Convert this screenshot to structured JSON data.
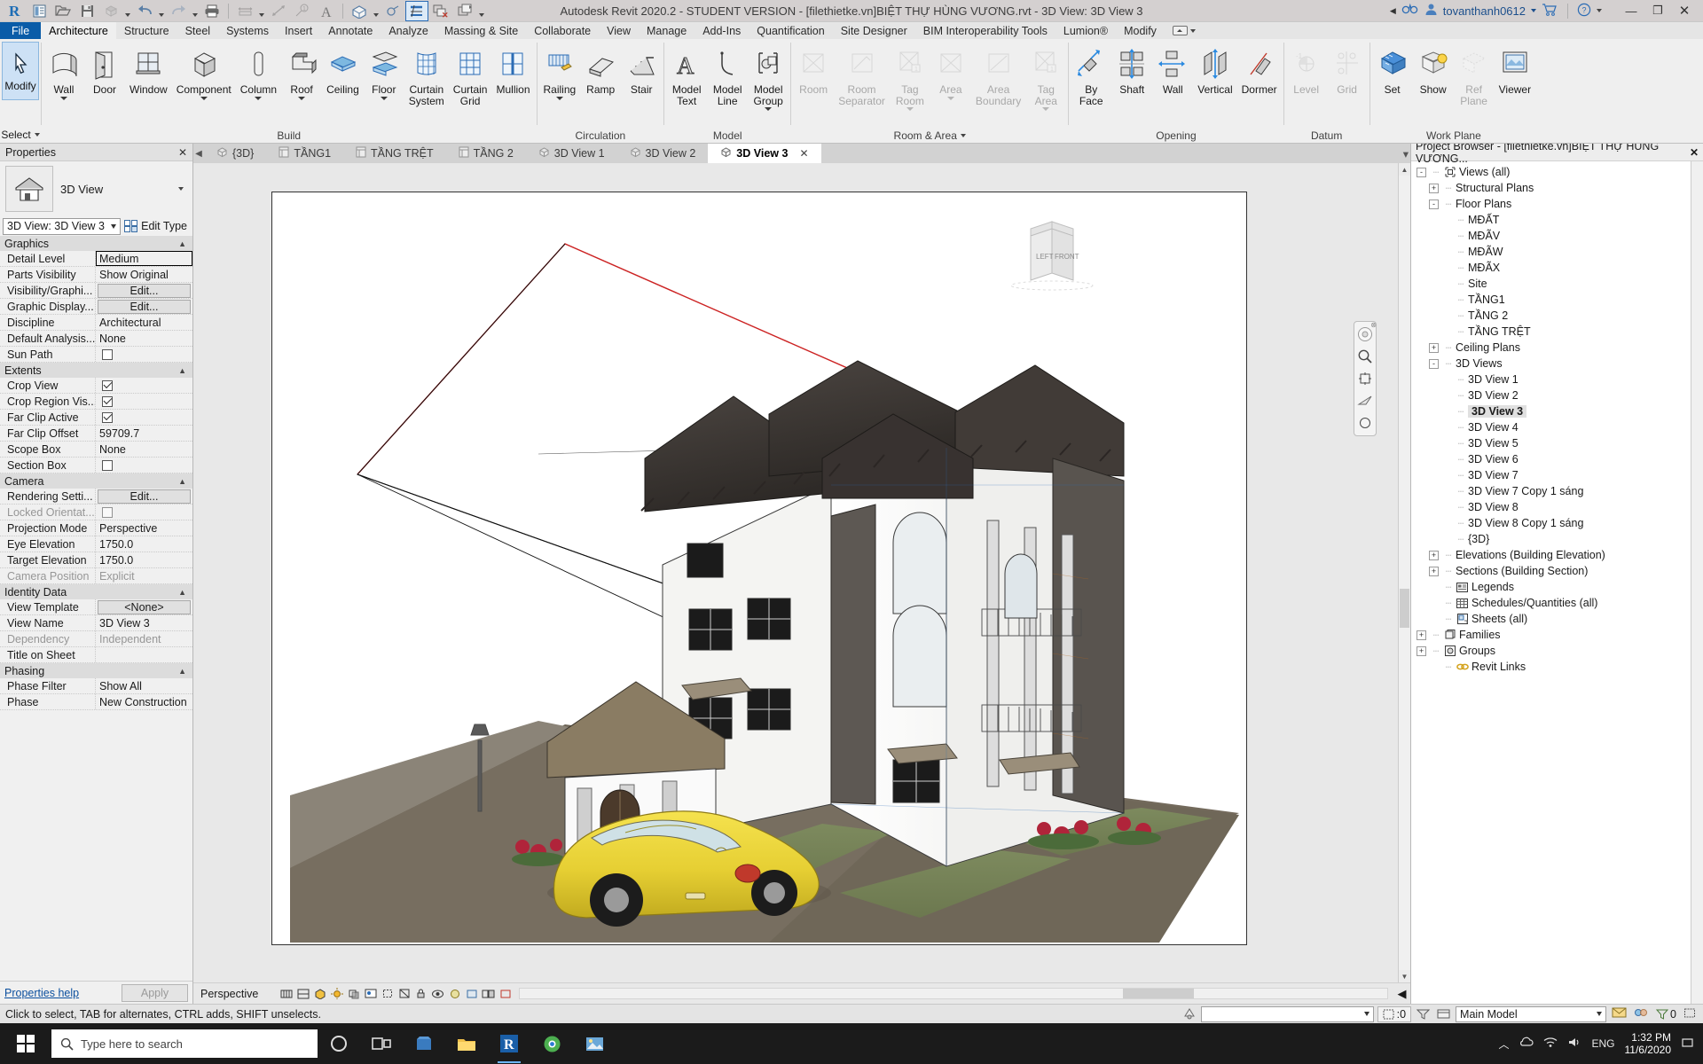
{
  "titlebar": {
    "title": "Autodesk Revit 2020.2 - STUDENT VERSION - [filethietke.vn]BIỆT THỰ HÙNG VƯƠNG.rvt - 3D View: 3D View 3",
    "user": "tovanthanh0612",
    "qat": [
      {
        "name": "revit-logo-icon",
        "label": "R"
      },
      {
        "name": "new-project-icon",
        "label": "New"
      },
      {
        "name": "open-icon",
        "label": "Open"
      },
      {
        "name": "save-icon",
        "label": "Save"
      },
      {
        "name": "sync-icon",
        "label": "Synchronize"
      },
      {
        "name": "undo-icon",
        "label": "Undo"
      },
      {
        "name": "redo-icon",
        "label": "Redo"
      },
      {
        "name": "print-icon",
        "label": "Print"
      },
      {
        "name": "measure-icon",
        "label": "Measure"
      },
      {
        "name": "aligned-dimension-icon",
        "label": "Aligned Dimension"
      },
      {
        "name": "tag-icon",
        "label": "Tag by Category"
      },
      {
        "name": "text-icon",
        "label": "Text"
      },
      {
        "name": "default-3d-view-icon",
        "label": "Default 3D View"
      },
      {
        "name": "section-icon",
        "label": "Section"
      },
      {
        "name": "thin-lines-icon",
        "label": "Thin Lines"
      },
      {
        "name": "close-hidden-windows-icon",
        "label": "Close Hidden Windows"
      },
      {
        "name": "switch-windows-icon",
        "label": "Switch Windows"
      }
    ],
    "buttons": {
      "minimize": "—",
      "maximize": "❐",
      "close": "✕"
    }
  },
  "ribbon": {
    "tabs": [
      {
        "label": "File",
        "state": "file"
      },
      {
        "label": "Architecture",
        "state": "active"
      },
      {
        "label": "Structure",
        "state": ""
      },
      {
        "label": "Steel",
        "state": ""
      },
      {
        "label": "Systems",
        "state": ""
      },
      {
        "label": "Insert",
        "state": ""
      },
      {
        "label": "Annotate",
        "state": ""
      },
      {
        "label": "Analyze",
        "state": ""
      },
      {
        "label": "Massing & Site",
        "state": ""
      },
      {
        "label": "Collaborate",
        "state": ""
      },
      {
        "label": "View",
        "state": ""
      },
      {
        "label": "Manage",
        "state": ""
      },
      {
        "label": "Add-Ins",
        "state": ""
      },
      {
        "label": "Quantification",
        "state": ""
      },
      {
        "label": "Site Designer",
        "state": ""
      },
      {
        "label": "BIM Interoperability Tools",
        "state": ""
      },
      {
        "label": "Lumion®",
        "state": ""
      },
      {
        "label": "Modify",
        "state": ""
      }
    ],
    "modify": {
      "label": "Modify",
      "select_label": "Select"
    },
    "panels": [
      {
        "title": "Build",
        "buttons": [
          {
            "label": "Wall",
            "icon": "wall-icon",
            "dropdown": true,
            "disabled": false
          },
          {
            "label": "Door",
            "icon": "door-icon",
            "dropdown": false,
            "disabled": false
          },
          {
            "label": "Window",
            "icon": "window-icon",
            "dropdown": false,
            "disabled": false
          },
          {
            "label": "Component",
            "icon": "component-icon",
            "dropdown": true,
            "disabled": false
          },
          {
            "label": "Column",
            "icon": "column-icon",
            "dropdown": true,
            "disabled": false
          },
          {
            "label": "Roof",
            "icon": "roof-icon",
            "dropdown": true,
            "disabled": false
          },
          {
            "label": "Ceiling",
            "icon": "ceiling-icon",
            "dropdown": false,
            "disabled": false
          },
          {
            "label": "Floor",
            "icon": "floor-icon",
            "dropdown": true,
            "disabled": false
          },
          {
            "label": "Curtain\nSystem",
            "icon": "curtain-system-icon",
            "dropdown": false,
            "disabled": false
          },
          {
            "label": "Curtain\nGrid",
            "icon": "curtain-grid-icon",
            "dropdown": false,
            "disabled": false
          },
          {
            "label": "Mullion",
            "icon": "mullion-icon",
            "dropdown": false,
            "disabled": false
          }
        ]
      },
      {
        "title": "Circulation",
        "buttons": [
          {
            "label": "Railing",
            "icon": "railing-icon",
            "dropdown": true,
            "disabled": false
          },
          {
            "label": "Ramp",
            "icon": "ramp-icon",
            "dropdown": false,
            "disabled": false
          },
          {
            "label": "Stair",
            "icon": "stair-icon",
            "dropdown": false,
            "disabled": false
          }
        ]
      },
      {
        "title": "Model",
        "buttons": [
          {
            "label": "Model\nText",
            "icon": "model-text-icon",
            "dropdown": false,
            "disabled": false
          },
          {
            "label": "Model\nLine",
            "icon": "model-line-icon",
            "dropdown": false,
            "disabled": false
          },
          {
            "label": "Model\nGroup",
            "icon": "model-group-icon",
            "dropdown": true,
            "disabled": false
          }
        ]
      },
      {
        "title": "Room & Area",
        "has_arrow": true,
        "buttons": [
          {
            "label": "Room",
            "icon": "room-icon",
            "dropdown": false,
            "disabled": true
          },
          {
            "label": "Room\nSeparator",
            "icon": "room-separator-icon",
            "dropdown": false,
            "disabled": true
          },
          {
            "label": "Tag\nRoom",
            "icon": "tag-room-icon",
            "dropdown": true,
            "disabled": true
          },
          {
            "label": "Area",
            "icon": "area-icon",
            "dropdown": true,
            "disabled": true
          },
          {
            "label": "Area\nBoundary",
            "icon": "area-boundary-icon",
            "dropdown": false,
            "disabled": true
          },
          {
            "label": "Tag\nArea",
            "icon": "tag-area-icon",
            "dropdown": true,
            "disabled": true
          }
        ]
      },
      {
        "title": "Opening",
        "buttons": [
          {
            "label": "By\nFace",
            "icon": "opening-by-face-icon",
            "dropdown": false,
            "disabled": false
          },
          {
            "label": "Shaft",
            "icon": "shaft-opening-icon",
            "dropdown": false,
            "disabled": false
          },
          {
            "label": "Wall",
            "icon": "wall-opening-icon",
            "dropdown": false,
            "disabled": false
          },
          {
            "label": "Vertical",
            "icon": "vertical-opening-icon",
            "dropdown": false,
            "disabled": false
          },
          {
            "label": "Dormer",
            "icon": "dormer-opening-icon",
            "dropdown": false,
            "disabled": false
          }
        ]
      },
      {
        "title": "Datum",
        "buttons": [
          {
            "label": "Level",
            "icon": "level-icon",
            "dropdown": false,
            "disabled": true
          },
          {
            "label": "Grid",
            "icon": "grid-icon",
            "dropdown": false,
            "disabled": true
          }
        ]
      },
      {
        "title": "Work Plane",
        "buttons": [
          {
            "label": "Set",
            "icon": "set-work-plane-icon",
            "dropdown": false,
            "disabled": false
          },
          {
            "label": "Show",
            "icon": "show-work-plane-icon",
            "dropdown": false,
            "disabled": false
          },
          {
            "label": "Ref\nPlane",
            "icon": "reference-plane-icon",
            "dropdown": false,
            "disabled": true
          },
          {
            "label": "Viewer",
            "icon": "work-plane-viewer-icon",
            "dropdown": false,
            "disabled": false
          }
        ]
      }
    ]
  },
  "properties": {
    "header": "Properties",
    "type_name": "3D View",
    "selector_value": "3D View: 3D View 3",
    "edit_type_label": "Edit Type",
    "groups": [
      {
        "name": "Graphics",
        "rows": [
          {
            "key": "Detail Level",
            "value": "Medium",
            "type": "text-boxed"
          },
          {
            "key": "Parts Visibility",
            "value": "Show Original",
            "type": "text"
          },
          {
            "key": "Visibility/Graphi...",
            "value": "Edit...",
            "type": "button"
          },
          {
            "key": "Graphic Display...",
            "value": "Edit...",
            "type": "button"
          },
          {
            "key": "Discipline",
            "value": "Architectural",
            "type": "text"
          },
          {
            "key": "Default Analysis...",
            "value": "None",
            "type": "text"
          },
          {
            "key": "Sun Path",
            "value": "",
            "type": "checkbox-off"
          }
        ]
      },
      {
        "name": "Extents",
        "rows": [
          {
            "key": "Crop View",
            "value": "",
            "type": "checkbox-on"
          },
          {
            "key": "Crop Region Vis...",
            "value": "",
            "type": "checkbox-on"
          },
          {
            "key": "Far Clip Active",
            "value": "",
            "type": "checkbox-on"
          },
          {
            "key": "Far Clip Offset",
            "value": "59709.7",
            "type": "text"
          },
          {
            "key": "Scope Box",
            "value": "None",
            "type": "text"
          },
          {
            "key": "Section Box",
            "value": "",
            "type": "checkbox-off"
          }
        ]
      },
      {
        "name": "Camera",
        "rows": [
          {
            "key": "Rendering Setti...",
            "value": "Edit...",
            "type": "button"
          },
          {
            "key": "Locked Orientat...",
            "value": "",
            "type": "checkbox-off",
            "dim": true
          },
          {
            "key": "Projection Mode",
            "value": "Perspective",
            "type": "text"
          },
          {
            "key": "Eye Elevation",
            "value": "1750.0",
            "type": "text"
          },
          {
            "key": "Target Elevation",
            "value": "1750.0",
            "type": "text"
          },
          {
            "key": "Camera Position",
            "value": "Explicit",
            "type": "text",
            "dim": true
          }
        ]
      },
      {
        "name": "Identity Data",
        "rows": [
          {
            "key": "View Template",
            "value": "<None>",
            "type": "button"
          },
          {
            "key": "View Name",
            "value": "3D View 3",
            "type": "text"
          },
          {
            "key": "Dependency",
            "value": "Independent",
            "type": "text",
            "dim": true
          },
          {
            "key": "Title on Sheet",
            "value": "",
            "type": "text"
          }
        ]
      },
      {
        "name": "Phasing",
        "rows": [
          {
            "key": "Phase Filter",
            "value": "Show All",
            "type": "text"
          },
          {
            "key": "Phase",
            "value": "New Construction",
            "type": "text"
          }
        ]
      }
    ],
    "footer": {
      "help": "Properties help",
      "apply": "Apply"
    }
  },
  "view_tabs": [
    {
      "label": "{3D}",
      "icon": "3d-view-icon",
      "active": false
    },
    {
      "label": "TẦNG1",
      "icon": "floor-plan-icon",
      "active": false
    },
    {
      "label": "TẦNG TRỆT",
      "icon": "floor-plan-icon",
      "active": false
    },
    {
      "label": "TẦNG 2",
      "icon": "floor-plan-icon",
      "active": false
    },
    {
      "label": "3D View 1",
      "icon": "3d-view-icon",
      "active": false
    },
    {
      "label": "3D View 2",
      "icon": "3d-view-icon",
      "active": false
    },
    {
      "label": "3D View 3",
      "icon": "3d-view-icon",
      "active": true,
      "close": "✕"
    }
  ],
  "viewcube": {
    "left": "LEFT",
    "front": "FRONT"
  },
  "view_controls": {
    "mode": "Perspective",
    "icons": [
      "scale-icon",
      "detail-level-icon",
      "visual-style-icon",
      "sun-path-icon",
      "shadows-icon",
      "rendering-dialog-icon",
      "crop-view-icon",
      "show-crop-region-icon",
      "lock-3d-view-icon",
      "temporary-hide-isolate-icon",
      "reveal-hidden-icon",
      "temporary-view-properties-icon",
      "hide-analytical-model-icon",
      "reveal-constraints-icon"
    ]
  },
  "browser": {
    "header": "Project Browser - [filethietke.vn]BIỆT THỰ HÙNG VƯƠNG...",
    "close": "✕",
    "tree": [
      {
        "label": "Views (all)",
        "depth": 0,
        "expander": "-",
        "icon": "views-icon"
      },
      {
        "label": "Structural Plans",
        "depth": 1,
        "expander": "+"
      },
      {
        "label": "Floor Plans",
        "depth": 1,
        "expander": "-"
      },
      {
        "label": "MĐẤT",
        "depth": 2,
        "expander": ""
      },
      {
        "label": "MĐÃV",
        "depth": 2,
        "expander": ""
      },
      {
        "label": "MĐÃW",
        "depth": 2,
        "expander": ""
      },
      {
        "label": "MĐÃX",
        "depth": 2,
        "expander": ""
      },
      {
        "label": "Site",
        "depth": 2,
        "expander": ""
      },
      {
        "label": "TẦNG1",
        "depth": 2,
        "expander": ""
      },
      {
        "label": "TẦNG 2",
        "depth": 2,
        "expander": ""
      },
      {
        "label": "TẦNG TRỆT",
        "depth": 2,
        "expander": ""
      },
      {
        "label": "Ceiling Plans",
        "depth": 1,
        "expander": "+"
      },
      {
        "label": "3D Views",
        "depth": 1,
        "expander": "-"
      },
      {
        "label": "3D View 1",
        "depth": 2,
        "expander": ""
      },
      {
        "label": "3D View 2",
        "depth": 2,
        "expander": ""
      },
      {
        "label": "3D View 3",
        "depth": 2,
        "expander": "",
        "selected": true
      },
      {
        "label": "3D View 4",
        "depth": 2,
        "expander": ""
      },
      {
        "label": "3D View 5",
        "depth": 2,
        "expander": ""
      },
      {
        "label": "3D View 6",
        "depth": 2,
        "expander": ""
      },
      {
        "label": "3D View 7",
        "depth": 2,
        "expander": ""
      },
      {
        "label": "3D View 7 Copy 1 sáng",
        "depth": 2,
        "expander": ""
      },
      {
        "label": "3D View 8",
        "depth": 2,
        "expander": ""
      },
      {
        "label": "3D View 8 Copy 1 sáng",
        "depth": 2,
        "expander": ""
      },
      {
        "label": "{3D}",
        "depth": 2,
        "expander": ""
      },
      {
        "label": "Elevations (Building Elevation)",
        "depth": 1,
        "expander": "+"
      },
      {
        "label": "Sections (Building Section)",
        "depth": 1,
        "expander": "+"
      },
      {
        "label": "Legends",
        "depth": 1,
        "expander": "",
        "icon": "legend-icon"
      },
      {
        "label": "Schedules/Quantities (all)",
        "depth": 1,
        "expander": "",
        "icon": "schedule-icon"
      },
      {
        "label": "Sheets (all)",
        "depth": 1,
        "expander": "",
        "icon": "sheet-icon"
      },
      {
        "label": "Families",
        "depth": 0,
        "expander": "+",
        "icon": "families-icon"
      },
      {
        "label": "Groups",
        "depth": 0,
        "expander": "+",
        "icon": "groups-icon"
      },
      {
        "label": "Revit Links",
        "depth": 1,
        "expander": "",
        "icon": "revit-links-icon"
      }
    ]
  },
  "statusbar": {
    "hint": "Click to select, TAB for alternates, CTRL adds, SHIFT unselects.",
    "filter_value": "",
    "count": ":0",
    "workset": "Main Model",
    "design_option_icon": "design-option-icon",
    "right_icons": [
      "editing-request-icon",
      "worksets-icon",
      "filter-icon",
      "hide-icon"
    ],
    "filter_count": "0"
  },
  "taskbar": {
    "search_placeholder": "Type here to search",
    "items": [
      {
        "name": "cortana-icon"
      },
      {
        "name": "task-view-icon"
      },
      {
        "name": "store-icon"
      },
      {
        "name": "file-explorer-icon"
      },
      {
        "name": "revit-taskbar-icon",
        "active": true
      },
      {
        "name": "chrome-icon"
      },
      {
        "name": "photos-icon"
      }
    ],
    "tray": {
      "language": "ENG",
      "time": "1:32 PM",
      "date": "11/6/2020"
    }
  },
  "colors": {
    "accent": "#0a5ca8",
    "ribbon_bg": "#efefef",
    "title_bg": "#d4d0d0",
    "selection": "#cde1f5",
    "taskbar": "#1b1b1b"
  }
}
